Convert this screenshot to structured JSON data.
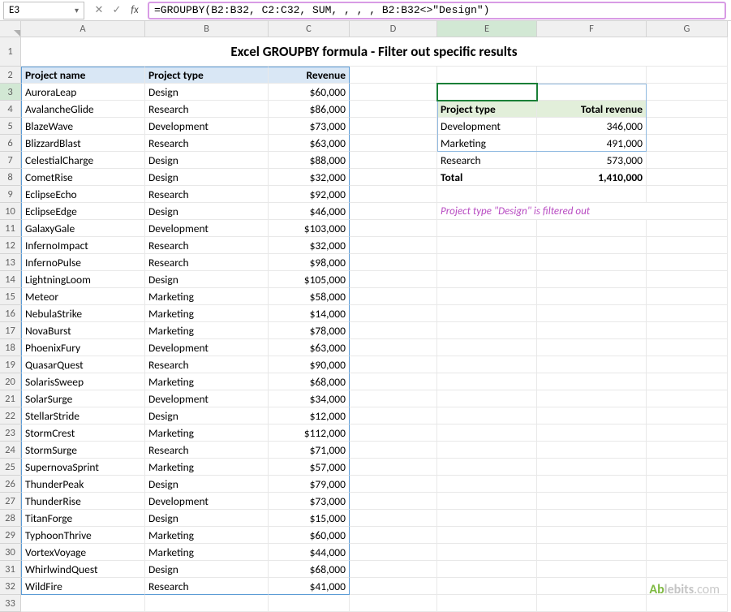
{
  "namebox": {
    "value": "E3"
  },
  "formula": "=GROUPBY(B2:B32, C2:C32, SUM, , , , B2:B32<>\"Design\")",
  "columns": [
    "A",
    "B",
    "C",
    "D",
    "E",
    "F",
    "G"
  ],
  "title": "Excel GROUPBY formula - Filter out specific results",
  "headers": {
    "A": "Project name",
    "B": "Project type",
    "C": "Revenue"
  },
  "data_rows": [
    {
      "r": "3",
      "a": "AuroraLeap",
      "b": "Design",
      "c": "$60,000"
    },
    {
      "r": "4",
      "a": "AvalancheGlide",
      "b": "Research",
      "c": "$86,000"
    },
    {
      "r": "5",
      "a": "BlazeWave",
      "b": "Development",
      "c": "$73,000"
    },
    {
      "r": "6",
      "a": "BlizzardBlast",
      "b": "Research",
      "c": "$63,000"
    },
    {
      "r": "7",
      "a": "CelestialCharge",
      "b": "Design",
      "c": "$88,000"
    },
    {
      "r": "8",
      "a": "CometRise",
      "b": "Design",
      "c": "$32,000"
    },
    {
      "r": "9",
      "a": "EclipseEcho",
      "b": "Research",
      "c": "$92,000"
    },
    {
      "r": "10",
      "a": "EclipseEdge",
      "b": "Design",
      "c": "$46,000"
    },
    {
      "r": "11",
      "a": "GalaxyGale",
      "b": "Development",
      "c": "$103,000"
    },
    {
      "r": "12",
      "a": "InfernoImpact",
      "b": "Research",
      "c": "$32,000"
    },
    {
      "r": "13",
      "a": "InfernoPulse",
      "b": "Research",
      "c": "$98,000"
    },
    {
      "r": "14",
      "a": "LightningLoom",
      "b": "Design",
      "c": "$105,000"
    },
    {
      "r": "15",
      "a": "Meteor",
      "b": "Marketing",
      "c": "$58,000"
    },
    {
      "r": "16",
      "a": "NebulaStrike",
      "b": "Marketing",
      "c": "$14,000"
    },
    {
      "r": "17",
      "a": "NovaBurst",
      "b": "Marketing",
      "c": "$78,000"
    },
    {
      "r": "18",
      "a": "PhoenixFury",
      "b": "Development",
      "c": "$63,000"
    },
    {
      "r": "19",
      "a": "QuasarQuest",
      "b": "Research",
      "c": "$90,000"
    },
    {
      "r": "20",
      "a": "SolarisSweep",
      "b": "Marketing",
      "c": "$68,000"
    },
    {
      "r": "21",
      "a": "SolarSurge",
      "b": "Development",
      "c": "$34,000"
    },
    {
      "r": "22",
      "a": "StellarStride",
      "b": "Design",
      "c": "$12,000"
    },
    {
      "r": "23",
      "a": "StormCrest",
      "b": "Marketing",
      "c": "$112,000"
    },
    {
      "r": "24",
      "a": "StormSurge",
      "b": "Research",
      "c": "$71,000"
    },
    {
      "r": "25",
      "a": "SupernovaSprint",
      "b": "Marketing",
      "c": "$57,000"
    },
    {
      "r": "26",
      "a": "ThunderPeak",
      "b": "Design",
      "c": "$79,000"
    },
    {
      "r": "27",
      "a": "ThunderRise",
      "b": "Development",
      "c": "$73,000"
    },
    {
      "r": "28",
      "a": "TitanForge",
      "b": "Design",
      "c": "$15,000"
    },
    {
      "r": "29",
      "a": "TyphoonThrive",
      "b": "Marketing",
      "c": "$60,000"
    },
    {
      "r": "30",
      "a": "VortexVoyage",
      "b": "Marketing",
      "c": "$44,000"
    },
    {
      "r": "31",
      "a": "WhirlwindQuest",
      "b": "Design",
      "c": "$68,000"
    },
    {
      "r": "32",
      "a": "WildFire",
      "b": "Research",
      "c": "$41,000"
    }
  ],
  "result": {
    "headers": {
      "E": "Project type",
      "F": "Total revenue"
    },
    "rows": [
      {
        "e": "Development",
        "f": "346,000"
      },
      {
        "e": "Marketing",
        "f": "491,000"
      },
      {
        "e": "Research",
        "f": "573,000"
      }
    ],
    "total": {
      "e": "Total",
      "f": "1,410,000"
    }
  },
  "note": "Project type \"Design\" is filtered out",
  "watermark": {
    "brand1": "Ab",
    "brand2": "lebits",
    "suffix": ".com"
  }
}
